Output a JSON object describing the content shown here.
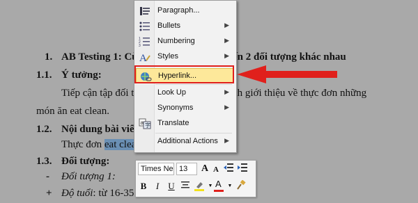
{
  "document": {
    "lines": [
      {
        "num": "1.",
        "text": "AB Testing 1: Cù",
        "text_right": "ến 2 đối tượng khác nhau"
      },
      {
        "num": "1.1.",
        "text": "Ý tưởng:"
      },
      {
        "text": "Tiếp cận tập đối tư",
        "text_right": "ch giới thiệu về thực đơn những"
      },
      {
        "text": "món ăn eat clean."
      },
      {
        "num": "1.2.",
        "text": "Nội dung bài viết:"
      },
      {
        "text_before": "Thực đơn ",
        "selected": "eat clean"
      },
      {
        "num": "1.3.",
        "text": "Đối tượng:"
      },
      {
        "num": "-",
        "text": "Đối tượng 1:"
      },
      {
        "num": "+",
        "text_italic": "Độ tuổi",
        "text": ": từ 16-35 tuổi"
      }
    ]
  },
  "context_menu": {
    "items": [
      {
        "label": "Paragraph...",
        "icon": "paragraph-icon",
        "submenu": false
      },
      {
        "label": "Bullets",
        "icon": "bullets-icon",
        "submenu": true
      },
      {
        "label": "Numbering",
        "icon": "numbering-icon",
        "submenu": true
      },
      {
        "label": "Styles",
        "icon": "styles-icon",
        "submenu": true
      },
      {
        "label": "Hyperlink...",
        "icon": "hyperlink-icon",
        "submenu": false,
        "highlighted": true
      },
      {
        "label": "Look Up",
        "icon": "",
        "submenu": true
      },
      {
        "label": "Synonyms",
        "icon": "",
        "submenu": true
      },
      {
        "label": "Translate",
        "icon": "translate-icon",
        "submenu": false
      },
      {
        "label": "Additional Actions",
        "icon": "",
        "submenu": true
      }
    ]
  },
  "mini_toolbar": {
    "font_name": "Times Ne",
    "font_size": "13",
    "bold": "B",
    "italic": "I",
    "underline": "U",
    "font_color_glyph": "A",
    "grow_font_glyph": "A",
    "shrink_font_glyph": "A"
  },
  "colors": {
    "highlight_box": "#e0201c",
    "selection": "#6a8fb4",
    "menu_highlight": "#fde89a"
  }
}
